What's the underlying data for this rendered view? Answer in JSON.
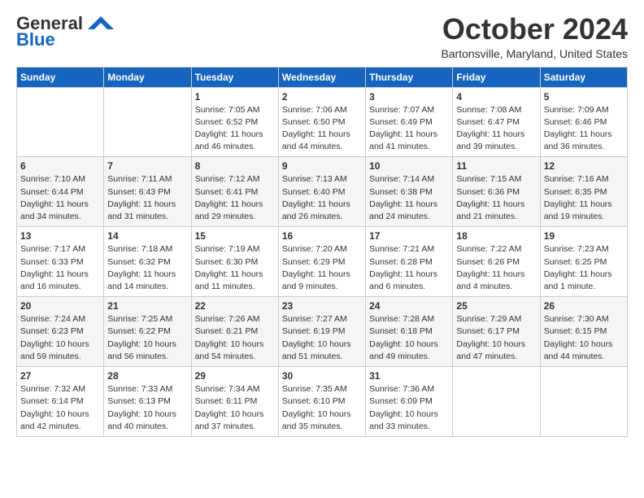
{
  "header": {
    "logo_line1": "General",
    "logo_line2": "Blue",
    "month": "October 2024",
    "location": "Bartonsville, Maryland, United States"
  },
  "weekdays": [
    "Sunday",
    "Monday",
    "Tuesday",
    "Wednesday",
    "Thursday",
    "Friday",
    "Saturday"
  ],
  "rows": [
    [
      {
        "day": "",
        "detail": ""
      },
      {
        "day": "",
        "detail": ""
      },
      {
        "day": "1",
        "detail": "Sunrise: 7:05 AM\nSunset: 6:52 PM\nDaylight: 11 hours and 46 minutes."
      },
      {
        "day": "2",
        "detail": "Sunrise: 7:06 AM\nSunset: 6:50 PM\nDaylight: 11 hours and 44 minutes."
      },
      {
        "day": "3",
        "detail": "Sunrise: 7:07 AM\nSunset: 6:49 PM\nDaylight: 11 hours and 41 minutes."
      },
      {
        "day": "4",
        "detail": "Sunrise: 7:08 AM\nSunset: 6:47 PM\nDaylight: 11 hours and 39 minutes."
      },
      {
        "day": "5",
        "detail": "Sunrise: 7:09 AM\nSunset: 6:46 PM\nDaylight: 11 hours and 36 minutes."
      }
    ],
    [
      {
        "day": "6",
        "detail": "Sunrise: 7:10 AM\nSunset: 6:44 PM\nDaylight: 11 hours and 34 minutes."
      },
      {
        "day": "7",
        "detail": "Sunrise: 7:11 AM\nSunset: 6:43 PM\nDaylight: 11 hours and 31 minutes."
      },
      {
        "day": "8",
        "detail": "Sunrise: 7:12 AM\nSunset: 6:41 PM\nDaylight: 11 hours and 29 minutes."
      },
      {
        "day": "9",
        "detail": "Sunrise: 7:13 AM\nSunset: 6:40 PM\nDaylight: 11 hours and 26 minutes."
      },
      {
        "day": "10",
        "detail": "Sunrise: 7:14 AM\nSunset: 6:38 PM\nDaylight: 11 hours and 24 minutes."
      },
      {
        "day": "11",
        "detail": "Sunrise: 7:15 AM\nSunset: 6:36 PM\nDaylight: 11 hours and 21 minutes."
      },
      {
        "day": "12",
        "detail": "Sunrise: 7:16 AM\nSunset: 6:35 PM\nDaylight: 11 hours and 19 minutes."
      }
    ],
    [
      {
        "day": "13",
        "detail": "Sunrise: 7:17 AM\nSunset: 6:33 PM\nDaylight: 11 hours and 16 minutes."
      },
      {
        "day": "14",
        "detail": "Sunrise: 7:18 AM\nSunset: 6:32 PM\nDaylight: 11 hours and 14 minutes."
      },
      {
        "day": "15",
        "detail": "Sunrise: 7:19 AM\nSunset: 6:30 PM\nDaylight: 11 hours and 11 minutes."
      },
      {
        "day": "16",
        "detail": "Sunrise: 7:20 AM\nSunset: 6:29 PM\nDaylight: 11 hours and 9 minutes."
      },
      {
        "day": "17",
        "detail": "Sunrise: 7:21 AM\nSunset: 6:28 PM\nDaylight: 11 hours and 6 minutes."
      },
      {
        "day": "18",
        "detail": "Sunrise: 7:22 AM\nSunset: 6:26 PM\nDaylight: 11 hours and 4 minutes."
      },
      {
        "day": "19",
        "detail": "Sunrise: 7:23 AM\nSunset: 6:25 PM\nDaylight: 11 hours and 1 minute."
      }
    ],
    [
      {
        "day": "20",
        "detail": "Sunrise: 7:24 AM\nSunset: 6:23 PM\nDaylight: 10 hours and 59 minutes."
      },
      {
        "day": "21",
        "detail": "Sunrise: 7:25 AM\nSunset: 6:22 PM\nDaylight: 10 hours and 56 minutes."
      },
      {
        "day": "22",
        "detail": "Sunrise: 7:26 AM\nSunset: 6:21 PM\nDaylight: 10 hours and 54 minutes."
      },
      {
        "day": "23",
        "detail": "Sunrise: 7:27 AM\nSunset: 6:19 PM\nDaylight: 10 hours and 51 minutes."
      },
      {
        "day": "24",
        "detail": "Sunrise: 7:28 AM\nSunset: 6:18 PM\nDaylight: 10 hours and 49 minutes."
      },
      {
        "day": "25",
        "detail": "Sunrise: 7:29 AM\nSunset: 6:17 PM\nDaylight: 10 hours and 47 minutes."
      },
      {
        "day": "26",
        "detail": "Sunrise: 7:30 AM\nSunset: 6:15 PM\nDaylight: 10 hours and 44 minutes."
      }
    ],
    [
      {
        "day": "27",
        "detail": "Sunrise: 7:32 AM\nSunset: 6:14 PM\nDaylight: 10 hours and 42 minutes."
      },
      {
        "day": "28",
        "detail": "Sunrise: 7:33 AM\nSunset: 6:13 PM\nDaylight: 10 hours and 40 minutes."
      },
      {
        "day": "29",
        "detail": "Sunrise: 7:34 AM\nSunset: 6:11 PM\nDaylight: 10 hours and 37 minutes."
      },
      {
        "day": "30",
        "detail": "Sunrise: 7:35 AM\nSunset: 6:10 PM\nDaylight: 10 hours and 35 minutes."
      },
      {
        "day": "31",
        "detail": "Sunrise: 7:36 AM\nSunset: 6:09 PM\nDaylight: 10 hours and 33 minutes."
      },
      {
        "day": "",
        "detail": ""
      },
      {
        "day": "",
        "detail": ""
      }
    ]
  ]
}
